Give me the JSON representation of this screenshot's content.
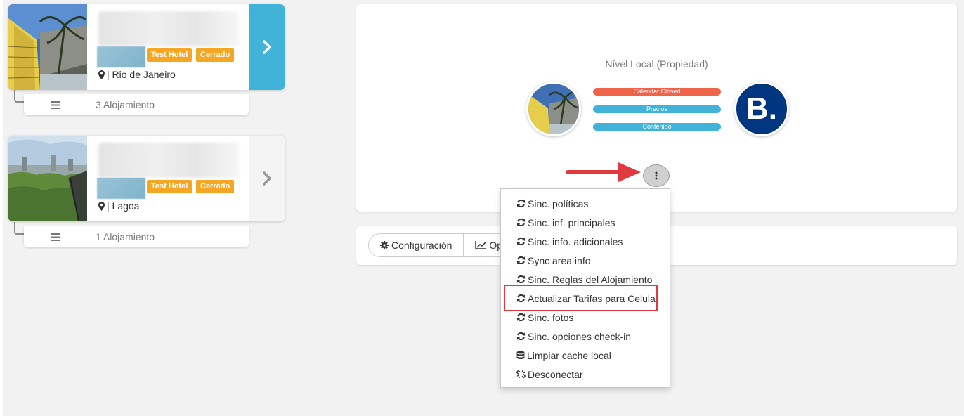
{
  "properties": [
    {
      "badges": [
        "Test Hotel",
        "Cerrado"
      ],
      "location": "| Rio de Janeiro",
      "units": "3 Alojamiento",
      "active": true
    },
    {
      "badges": [
        "Test Hotel",
        "Cerrado"
      ],
      "location": "| Lagoa",
      "units": "1 Alojamiento",
      "active": false
    }
  ],
  "panel": {
    "title": "Nível Local (Propiedad)",
    "channel_logo": "B.",
    "status_pills": [
      {
        "label": "Calendar Closed",
        "color": "#ee6449"
      },
      {
        "label": "Precios",
        "color": "#41b3d8"
      },
      {
        "label": "Contenido",
        "color": "#41b3d8"
      }
    ]
  },
  "toolbar": {
    "config_label": "Configuración",
    "ops_label": "Op"
  },
  "dropdown": {
    "items": [
      {
        "icon": "sync-icon",
        "label": "Sinc. políticas"
      },
      {
        "icon": "sync-icon",
        "label": "Sinc. inf. principales"
      },
      {
        "icon": "sync-icon",
        "label": "Sinc. info. adicionales"
      },
      {
        "icon": "sync-icon",
        "label": "Sync area info"
      },
      {
        "icon": "sync-icon",
        "label": "Sinc. Reglas del Alojamiento"
      },
      {
        "icon": "sync-icon",
        "label": "Actualizar Tarifas para Celular"
      },
      {
        "icon": "sync-icon",
        "label": "Sinc. fotos"
      },
      {
        "icon": "sync-icon",
        "label": "Sinc. opciones check-in"
      },
      {
        "icon": "database-icon",
        "label": "Limpiar cache local"
      },
      {
        "icon": "unlink-icon",
        "label": "Desconectar"
      }
    ],
    "highlighted_index": 5
  },
  "colors": {
    "accent": "#41b3d8",
    "badge": "#f5a623",
    "booking": "#003580",
    "highlight": "#e0393e"
  }
}
